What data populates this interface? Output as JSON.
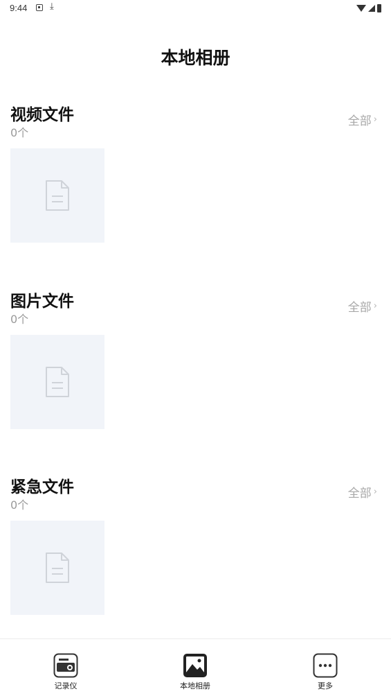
{
  "status_bar": {
    "time": "9:44",
    "download_glyph": "⤓"
  },
  "header": {
    "title": "本地相册"
  },
  "sections": [
    {
      "title": "视频文件",
      "count": "0个",
      "all_label": "全部",
      "chevron": "›",
      "thumbnail_icon": "document-placeholder-icon"
    },
    {
      "title": "图片文件",
      "count": "0个",
      "all_label": "全部",
      "chevron": "›",
      "thumbnail_icon": "document-placeholder-icon"
    },
    {
      "title": "紧急文件",
      "count": "0个",
      "all_label": "全部",
      "chevron": "›",
      "thumbnail_icon": "document-placeholder-icon"
    }
  ],
  "tab_bar": {
    "items": [
      {
        "label": "记录仪",
        "icon": "dashcam-icon",
        "active": false
      },
      {
        "label": "本地相册",
        "icon": "photo-album-icon",
        "active": true
      },
      {
        "label": "更多",
        "icon": "more-dots-icon",
        "active": false
      }
    ]
  }
}
